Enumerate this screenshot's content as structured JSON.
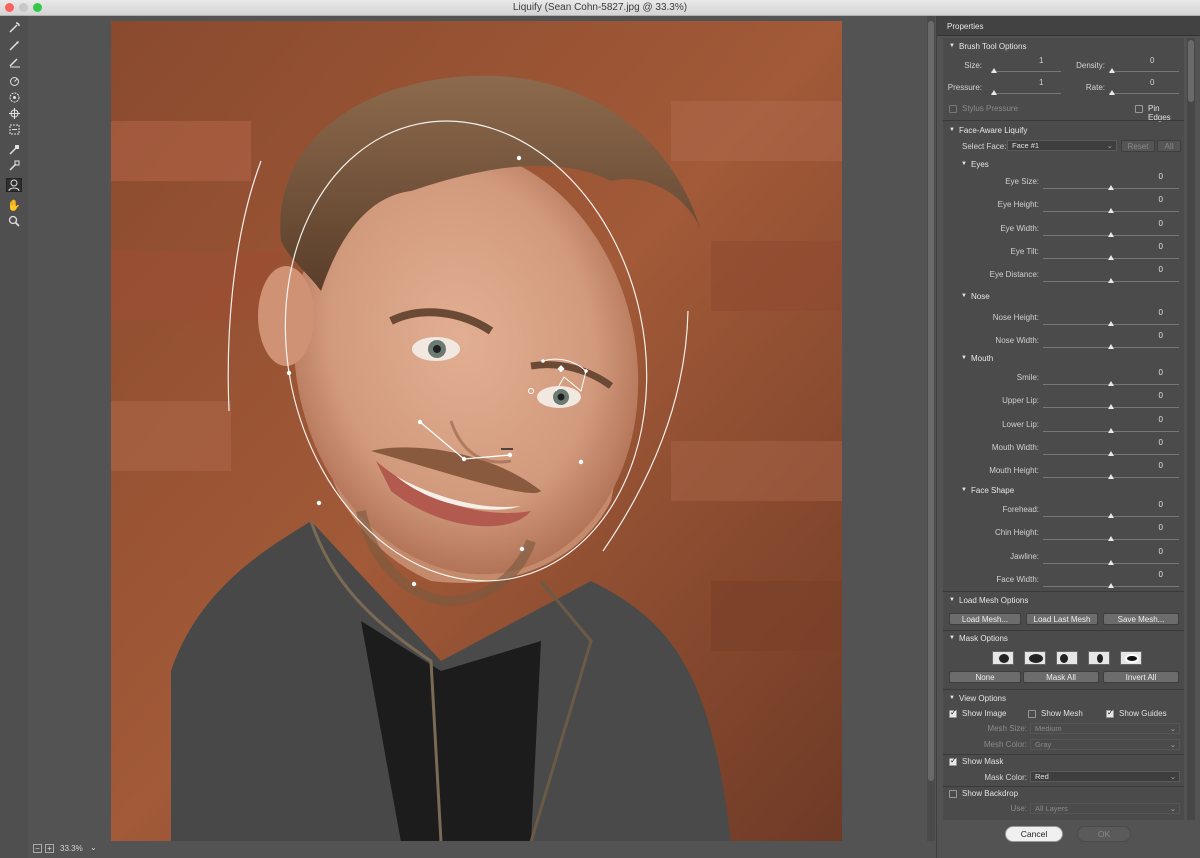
{
  "window": {
    "title": "Liquify (Sean Cohn-5827.jpg @ 33.3%)"
  },
  "toolbar": {
    "tools": [
      "forward-warp",
      "reconstruct",
      "smooth",
      "twirl",
      "pucker",
      "bloat",
      "push-left",
      "freeze-mask",
      "thaw-mask",
      "face-tool",
      "hand",
      "zoom"
    ]
  },
  "status": {
    "zoom": "33.3%",
    "zoom_dropdown": "⌄",
    "zoom_out": "−",
    "zoom_in": "+"
  },
  "panel": {
    "title": "Properties",
    "brush": {
      "heading": "Brush Tool Options",
      "size_label": "Size:",
      "size_value": "1",
      "density_label": "Density:",
      "density_value": "0",
      "pressure_label": "Pressure:",
      "pressure_value": "1",
      "rate_label": "Rate:",
      "rate_value": "0",
      "stylus_label": "Stylus Pressure",
      "pin_edges_label": "Pin Edges"
    },
    "face": {
      "heading": "Face-Aware Liquify",
      "select_face_label": "Select Face:",
      "select_face_value": "Face #1",
      "reset_label": "Reset",
      "all_label": "All",
      "eyes_heading": "Eyes",
      "eyes": [
        {
          "label": "Eye Size:",
          "value": "0"
        },
        {
          "label": "Eye Height:",
          "value": "0"
        },
        {
          "label": "Eye Width:",
          "value": "0"
        },
        {
          "label": "Eye Tilt:",
          "value": "0"
        },
        {
          "label": "Eye Distance:",
          "value": "0"
        }
      ],
      "nose_heading": "Nose",
      "nose": [
        {
          "label": "Nose Height:",
          "value": "0"
        },
        {
          "label": "Nose Width:",
          "value": "0"
        }
      ],
      "mouth_heading": "Mouth",
      "mouth": [
        {
          "label": "Smile:",
          "value": "0"
        },
        {
          "label": "Upper Lip:",
          "value": "0"
        },
        {
          "label": "Lower Lip:",
          "value": "0"
        },
        {
          "label": "Mouth Width:",
          "value": "0"
        },
        {
          "label": "Mouth Height:",
          "value": "0"
        }
      ],
      "shape_heading": "Face Shape",
      "shape": [
        {
          "label": "Forehead:",
          "value": "0"
        },
        {
          "label": "Chin Height:",
          "value": "0"
        },
        {
          "label": "Jawline:",
          "value": "0"
        },
        {
          "label": "Face Width:",
          "value": "0"
        }
      ]
    },
    "mesh": {
      "heading": "Load Mesh Options",
      "load_label": "Load Mesh...",
      "load_last_label": "Load Last Mesh",
      "save_label": "Save Mesh..."
    },
    "mask": {
      "heading": "Mask Options",
      "none_label": "None",
      "mask_all_label": "Mask All",
      "invert_all_label": "Invert All"
    },
    "view": {
      "heading": "View Options",
      "show_image_label": "Show Image",
      "show_mesh_label": "Show Mesh",
      "show_guides_label": "Show Guides",
      "mesh_size_label": "Mesh Size:",
      "mesh_size_value": "Medium",
      "mesh_color_label": "Mesh Color:",
      "mesh_color_value": "Gray",
      "show_mask_label": "Show Mask",
      "mask_color_label": "Mask Color:",
      "mask_color_value": "Red",
      "show_backdrop_label": "Show Backdrop",
      "use_label": "Use:",
      "use_value": "All Layers"
    },
    "cancel_label": "Cancel",
    "ok_label": "OK"
  },
  "colors": {
    "panel_bg": "#535353",
    "section_bg": "#4b4b4b",
    "title_bar": "#e0e0e0",
    "close": "#fc605b",
    "minimize": "#fdbc40",
    "zoom": "#34c84a"
  }
}
